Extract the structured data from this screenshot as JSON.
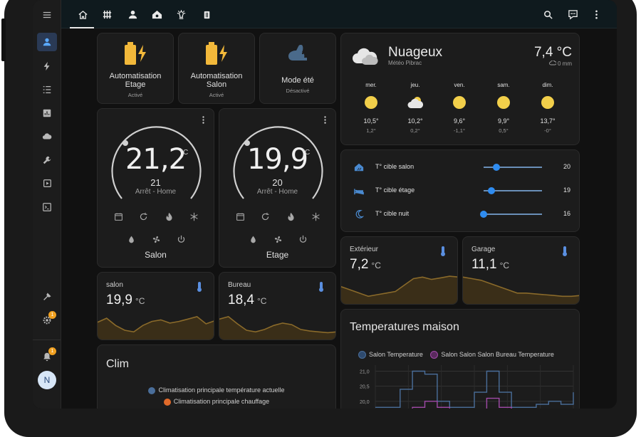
{
  "topbar": {
    "tabs": [
      {
        "icon": "home-icon"
      },
      {
        "icon": "radiator-icon"
      },
      {
        "icon": "person-icon"
      },
      {
        "icon": "house-shield-icon"
      },
      {
        "icon": "lamp-icon"
      },
      {
        "icon": "trash-icon"
      }
    ],
    "actions": [
      {
        "icon": "search-icon"
      },
      {
        "icon": "assist-icon"
      },
      {
        "icon": "more-vertical-icon"
      }
    ]
  },
  "sidebar": {
    "items": [
      {
        "icon": "menu-icon"
      },
      {
        "icon": "person-icon"
      },
      {
        "icon": "lightning-icon"
      },
      {
        "icon": "list-icon"
      },
      {
        "icon": "chart-icon"
      },
      {
        "icon": "cloud-icon"
      },
      {
        "icon": "wrench-icon"
      },
      {
        "icon": "media-icon"
      },
      {
        "icon": "terminal-icon"
      },
      {
        "icon": "hammer-icon"
      },
      {
        "icon": "settings-icon"
      },
      {
        "icon": "bell-icon"
      }
    ],
    "settings_badge": "1",
    "notifications_badge": "1",
    "avatar": "N"
  },
  "buttons": [
    {
      "title": "Automatisation Etage",
      "state": "Activé",
      "icon": "battery-charging-icon"
    },
    {
      "title": "Automatisation Salon",
      "state": "Activé",
      "icon": "battery-charging-icon"
    },
    {
      "title": "Mode été",
      "state": "Désactivé",
      "icon": "rabbit-icon"
    }
  ],
  "thermostats": [
    {
      "name": "Salon",
      "current": "21,2",
      "unit": "°C",
      "target": "21",
      "mode": "Arrêt - Home"
    },
    {
      "name": "Etage",
      "current": "19,9",
      "unit": "°C",
      "target": "20",
      "mode": "Arrêt - Home"
    }
  ],
  "sensors": [
    {
      "name": "salon",
      "value": "19,9",
      "unit": "°C",
      "trend": [
        18,
        23,
        14,
        8,
        6,
        14,
        19,
        21,
        17,
        19,
        22,
        25,
        16,
        20
      ]
    },
    {
      "name": "Bureau",
      "value": "18,4",
      "unit": "°C",
      "trend": [
        22,
        25,
        16,
        8,
        6,
        9,
        14,
        17,
        15,
        9,
        7,
        6,
        5,
        6
      ]
    },
    {
      "name": "Extérieur",
      "value": "7,2",
      "unit": "°C",
      "trend": [
        18,
        14,
        10,
        6,
        8,
        10,
        12,
        20,
        28,
        30,
        27,
        29,
        31,
        30
      ]
    },
    {
      "name": "Garage",
      "value": "11,1",
      "unit": "°C",
      "trend": [
        30,
        28,
        26,
        22,
        18,
        14,
        10,
        10,
        9,
        8,
        7,
        6,
        6,
        7
      ]
    }
  ],
  "weather": {
    "condition": "Nuageux",
    "location": "Météo Pibrac",
    "temperature": "7,4 °C",
    "precipitation": "0 mm",
    "forecast": [
      {
        "day": "mer.",
        "icon": "sun-icon",
        "high": "10,5°",
        "low": "1,2°"
      },
      {
        "day": "jeu.",
        "icon": "partly-cloudy-icon",
        "high": "10,2°",
        "low": "0,2°"
      },
      {
        "day": "ven.",
        "icon": "sun-icon",
        "high": "9,6°",
        "low": "-1,1°"
      },
      {
        "day": "sam.",
        "icon": "sun-icon",
        "high": "9,9°",
        "low": "0,5°"
      },
      {
        "day": "dim.",
        "icon": "sun-icon",
        "high": "13,7°",
        "low": "-0°"
      }
    ]
  },
  "targets": [
    {
      "label": "T° cible salon",
      "value": "20",
      "fraction": 0.22,
      "icon": "home-heat-icon"
    },
    {
      "label": "T° cible étage",
      "value": "19",
      "fraction": 0.14,
      "icon": "bed-icon"
    },
    {
      "label": "T° cible nuit",
      "value": "16",
      "fraction": 0.0,
      "icon": "moon-icon"
    }
  ],
  "clim": {
    "title": "Clim",
    "legend": [
      "Climatisation principale température actuelle",
      "Climatisation principale chauffage"
    ],
    "colors": [
      "#4a6e9a",
      "#e06a2a"
    ]
  },
  "chart_data": {
    "type": "line",
    "title": "Temperatures maison",
    "series": [
      {
        "name": "Salon Temperature",
        "color": "#4a6e9a",
        "values": [
          19.8,
          19.8,
          20.4,
          21.0,
          20.9,
          20.0,
          19.8,
          19.8,
          20.3,
          21.0,
          20.3,
          19.8,
          19.8,
          19.9,
          20.0,
          19.9,
          20.3
        ]
      },
      {
        "name": "Salon Salon Salon Bureau Temperature",
        "color": "#a04aa8",
        "values": [
          19.6,
          19.6,
          19.7,
          19.8,
          20.0,
          19.8,
          19.6,
          19.6,
          19.7,
          20.1,
          19.8,
          19.6,
          19.6,
          19.6,
          19.6,
          19.6,
          19.6
        ]
      }
    ],
    "y_ticks": [
      "21,0",
      "20,5",
      "20,0"
    ],
    "ylim": [
      19.5,
      21.2
    ]
  },
  "colors": {
    "accent": "#2f8cf0",
    "battery": "#f2b83a",
    "sparkline": "#8a6a2a",
    "thermometer": "#5a8fe0"
  }
}
